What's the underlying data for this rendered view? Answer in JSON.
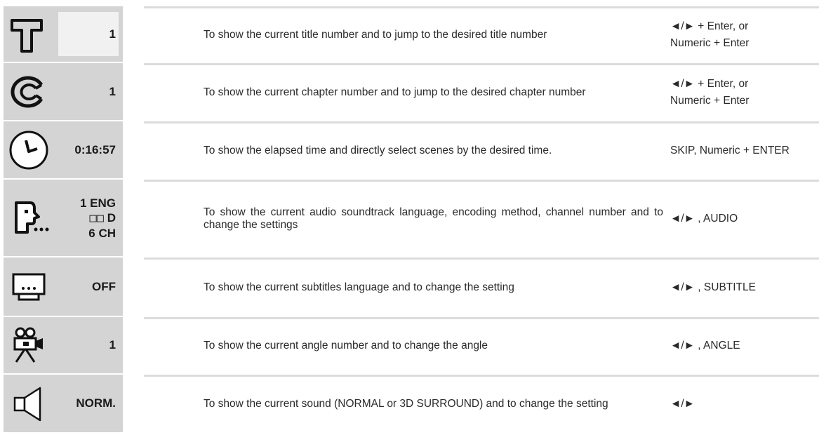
{
  "rows": [
    {
      "icon": "title-icon",
      "value": "1",
      "description": "To show the current title number and to jump to the desired title number",
      "buttons_line1": "◄/► + Enter, or",
      "buttons_line2": "Numeric + Enter"
    },
    {
      "icon": "chapter-icon",
      "value": "1",
      "description": "To show the current chapter number and to jump to the desired chapter number",
      "buttons_line1": "◄/► + Enter, or",
      "buttons_line2": "Numeric + Enter"
    },
    {
      "icon": "clock-icon",
      "value": "0:16:57",
      "description": "To show the elapsed time and directly select scenes by the desired time.",
      "buttons_line1": "SKIP, Numeric + ENTER"
    },
    {
      "icon": "audio-speaking-head-icon",
      "value_line1": "1  ENG",
      "value_line2": "D D",
      "value_line3": "6  CH",
      "description": "To show the current audio soundtrack language, encoding method, channel number and to change the settings",
      "buttons_line1": "◄/► , AUDIO"
    },
    {
      "icon": "subtitle-icon",
      "value": "OFF",
      "description": "To show the current subtitles language and to change the setting",
      "buttons_line1": "◄/► , SUBTITLE"
    },
    {
      "icon": "camera-angle-icon",
      "value": "1",
      "description": "To show the current angle number and to change the angle",
      "buttons_line1": "◄/► , ANGLE"
    },
    {
      "icon": "speaker-icon",
      "value": "NORM.",
      "description": "To show the current sound (NORMAL or 3D SURROUND) and to change the setting",
      "buttons_line1": "◄/►"
    }
  ],
  "colors": {
    "osd_background": "#d4d4d4",
    "value_box": "#f1f1f1",
    "divider": "#dcdcdc",
    "text": "#2a2a2a"
  }
}
